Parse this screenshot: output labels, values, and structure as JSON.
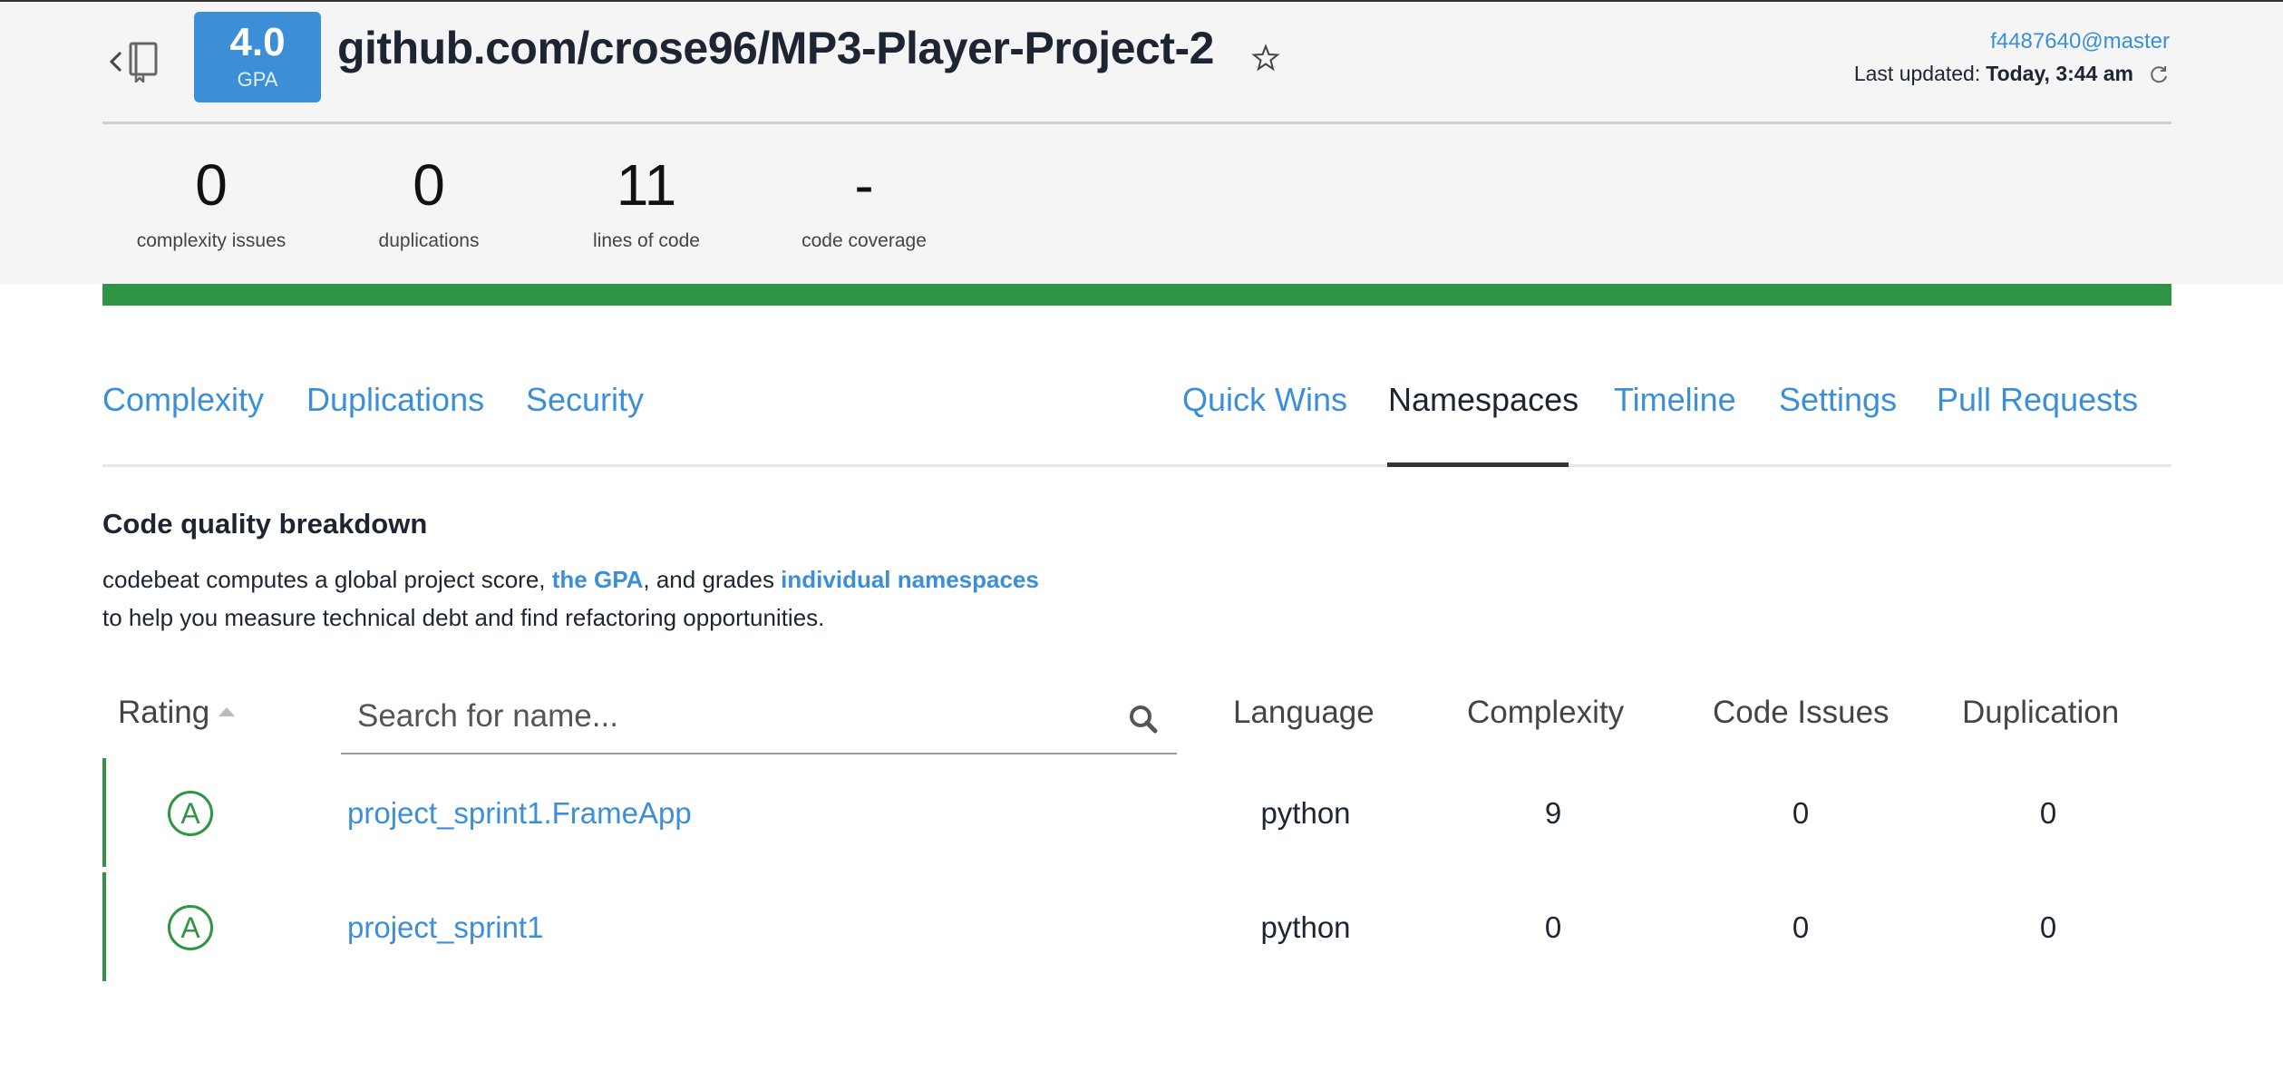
{
  "header": {
    "gpa_value": "4.0",
    "gpa_label": "GPA",
    "repo_title": "github.com/crose96/MP3-Player-Project-2",
    "commit_ref": "f4487640@master",
    "last_updated_label": "Last updated:",
    "last_updated_value": "Today, 3:44 am",
    "icons": [
      "back-chevron-icon",
      "repo-book-icon",
      "star-icon",
      "refresh-icon"
    ]
  },
  "stats": [
    {
      "value": "0",
      "label": "complexity issues"
    },
    {
      "value": "0",
      "label": "duplications"
    },
    {
      "value": "11",
      "label": "lines of code"
    },
    {
      "value": "-",
      "label": "code coverage"
    }
  ],
  "progress_color": "#2f9444",
  "tabs_left": [
    "Complexity",
    "Duplications",
    "Security"
  ],
  "tabs_right": [
    "Quick Wins",
    "Namespaces",
    "Timeline",
    "Settings",
    "Pull Requests"
  ],
  "active_tab": "Namespaces",
  "section": {
    "title": "Code quality breakdown",
    "desc_part1": "codebeat computes a global project score, ",
    "desc_link1": "the GPA",
    "desc_part2": ", and grades ",
    "desc_link2": "individual namespaces",
    "desc_line2": "to help you measure technical debt and find refactoring opportunities."
  },
  "table": {
    "headers": {
      "rating": "Rating",
      "language": "Language",
      "complexity": "Complexity",
      "code_issues": "Code Issues",
      "duplication": "Duplication"
    },
    "search_placeholder": "Search for name...",
    "rows": [
      {
        "grade": "A",
        "name": "project_sprint1.FrameApp",
        "language": "python",
        "complexity": "9",
        "code_issues": "0",
        "duplication": "0"
      },
      {
        "grade": "A",
        "name": "project_sprint1",
        "language": "python",
        "complexity": "0",
        "code_issues": "0",
        "duplication": "0"
      }
    ]
  },
  "colors": {
    "accent_blue": "#3c8fd6",
    "grade_green": "#2f9444",
    "text_dark": "#1d2533"
  }
}
